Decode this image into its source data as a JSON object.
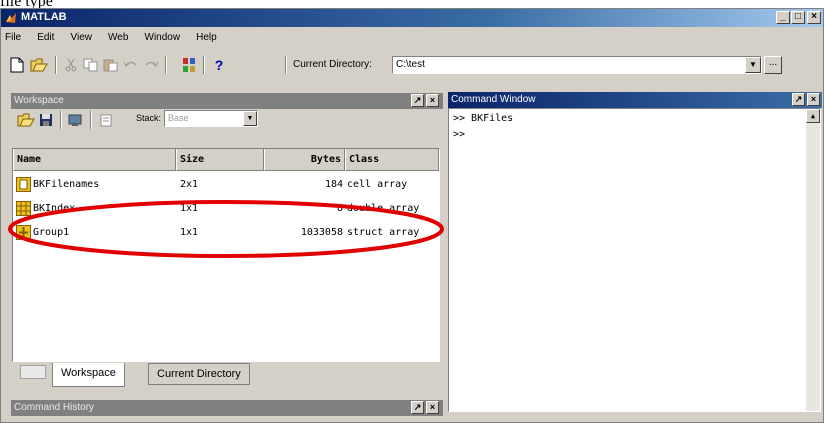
{
  "caption": "file type",
  "window": {
    "title": "MATLAB",
    "controls": {
      "minimize": "_",
      "maximize": "□",
      "close": "×"
    }
  },
  "menu": [
    "File",
    "Edit",
    "View",
    "Web",
    "Window",
    "Help"
  ],
  "toolbar": {
    "icons": [
      "new-file-icon",
      "open-folder-icon",
      "cut-icon",
      "copy-icon",
      "paste-icon",
      "undo-icon",
      "redo-icon",
      "simulink-icon",
      "help-icon"
    ],
    "help_glyph": "?",
    "current_directory_label": "Current Directory:",
    "current_directory_value": "C:\\test",
    "browse_label": "..."
  },
  "workspace": {
    "title": "Workspace",
    "stack_label": "Stack:",
    "stack_value": "Base",
    "columns": [
      "Name",
      "Size",
      "Bytes",
      "Class"
    ],
    "rows": [
      {
        "name": "BKFilenames",
        "size": "2x1",
        "bytes": "184",
        "class": "cell array",
        "icon": "cell-array-icon"
      },
      {
        "name": "BKIndex",
        "size": "1x1",
        "bytes": "8",
        "class": "double array",
        "icon": "matrix-icon"
      },
      {
        "name": "Group1",
        "size": "1x1",
        "bytes": "1033058",
        "class": "struct array",
        "icon": "struct-icon"
      }
    ],
    "highlight_color": "#e00000"
  },
  "tabs": [
    "Workspace",
    "Current Directory"
  ],
  "command_window": {
    "title": "Command Window",
    "lines": [
      ">> BKFiles",
      ">>"
    ]
  },
  "command_history": {
    "title": "Command History"
  },
  "pane_buttons": {
    "undock": "↗",
    "close": "×"
  },
  "colors": {
    "title_active": "#0a246a",
    "title_inactive": "#808080",
    "chrome": "#d4d0c8"
  }
}
